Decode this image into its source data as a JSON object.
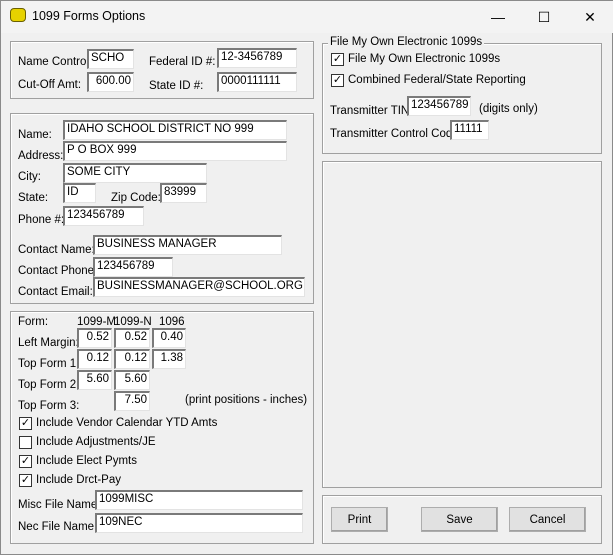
{
  "window": {
    "title": "1099 Forms Options",
    "minimize": "—",
    "maximize": "☐",
    "close": "✕"
  },
  "ids": {
    "name_control_label": "Name Control:",
    "name_control": "SCHO",
    "cutoff_label": "Cut-Off Amt:",
    "cutoff": "600.00",
    "federal_label": "Federal ID #:",
    "federal": "12-3456789",
    "state_label": "State ID #:",
    "state": "0000111111"
  },
  "address": {
    "name_label": "Name:",
    "name": "IDAHO SCHOOL DISTRICT NO 999",
    "address_label": "Address:",
    "address": "P O BOX 999",
    "city_label": "City:",
    "city": "SOME CITY",
    "state_label": "State:",
    "state": "ID",
    "zip_label": "Zip Code:",
    "zip": "83999",
    "phone_label": "Phone #:",
    "phone": "123456789",
    "contact_name_label": "Contact Name:",
    "contact_name": "BUSINESS MANAGER",
    "contact_phone_label": "Contact Phone:",
    "contact_phone": "123456789",
    "contact_email_label": "Contact Email:",
    "contact_email": "BUSINESSMANAGER@SCHOOL.ORG"
  },
  "forms": {
    "form_label": "Form:",
    "cols": [
      "1099-M",
      "1099-N",
      "1096"
    ],
    "rows": [
      {
        "label": "Left Margin:",
        "values": [
          "0.52",
          "0.52",
          "0.40"
        ]
      },
      {
        "label": "Top Form 1:",
        "values": [
          "0.12",
          "0.12",
          "1.38"
        ]
      },
      {
        "label": "Top Form 2:",
        "values": [
          "5.60",
          "5.60"
        ]
      },
      {
        "label": "Top Form 3:",
        "values": [
          "",
          "7.50"
        ]
      }
    ],
    "note": "(print positions - inches)",
    "checks": [
      {
        "label": "Include Vendor Calendar YTD Amts",
        "checked": true
      },
      {
        "label": "Include Adjustments/JE",
        "checked": false
      },
      {
        "label": "Include Elect Pymts",
        "checked": true
      },
      {
        "label": "Include Drct-Pay",
        "checked": true
      }
    ],
    "misc_label": "Misc File Name:",
    "misc": "1099MISC",
    "nec_label": "Nec File Name:",
    "nec": "109NEC"
  },
  "electronic": {
    "title": "File My Own Electronic 1099s",
    "checks": [
      {
        "label": "File My Own Electronic 1099s",
        "checked": true
      },
      {
        "label": "Combined Federal/State Reporting",
        "checked": true
      }
    ],
    "tin_label": "Transmitter TIN:",
    "tin": "123456789",
    "tin_hint": "(digits only)",
    "tcc_label": "Transmitter Control Code:",
    "tcc": "11111"
  },
  "buttons": {
    "print": "Print",
    "save": "Save",
    "cancel": "Cancel"
  }
}
